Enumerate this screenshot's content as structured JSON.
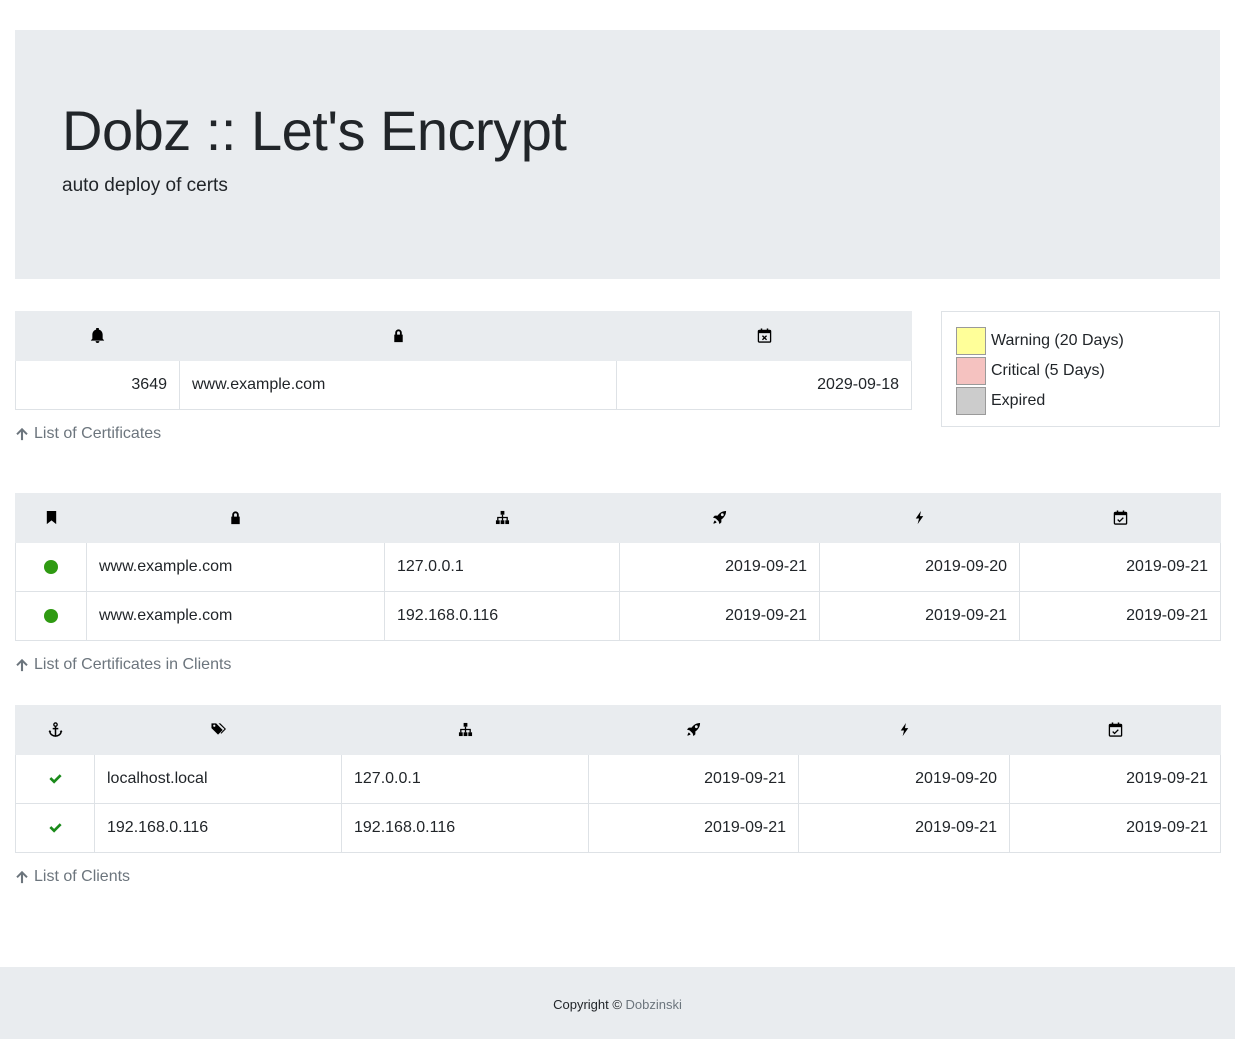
{
  "header": {
    "title": "Dobz :: Let's Encrypt",
    "subtitle": "auto deploy of certs"
  },
  "certificates": {
    "columns": [
      "bell-icon",
      "lock-icon",
      "calendar-x-icon"
    ],
    "rows": [
      {
        "days": "3649",
        "domain": "www.example.com",
        "expires": "2029-09-18"
      }
    ],
    "link_label": "List of Certificates"
  },
  "legend": {
    "items": [
      {
        "label": "Warning (20 Days)",
        "color": "#ffff99"
      },
      {
        "label": "Critical (5 Days)",
        "color": "#f5c2c0"
      },
      {
        "label": "Expired",
        "color": "#cccccc"
      }
    ]
  },
  "client_certificates": {
    "columns": [
      "bookmark-icon",
      "lock-icon",
      "sitemap-icon",
      "rocket-icon",
      "bolt-icon",
      "calendar-check-icon"
    ],
    "status_color": "#2f9a12",
    "rows": [
      {
        "domain": "www.example.com",
        "ip": "127.0.0.1",
        "deployed": "2019-09-21",
        "triggered": "2019-09-20",
        "checked": "2019-09-21"
      },
      {
        "domain": "www.example.com",
        "ip": "192.168.0.116",
        "deployed": "2019-09-21",
        "triggered": "2019-09-21",
        "checked": "2019-09-21"
      }
    ],
    "link_label": "List of Certificates in Clients"
  },
  "clients": {
    "columns": [
      "anchor-icon",
      "tags-icon",
      "sitemap-icon",
      "rocket-icon",
      "bolt-icon",
      "calendar-check-icon"
    ],
    "rows": [
      {
        "name": "localhost.local",
        "ip": "127.0.0.1",
        "deployed": "2019-09-21",
        "triggered": "2019-09-20",
        "checked": "2019-09-21"
      },
      {
        "name": "192.168.0.116",
        "ip": "192.168.0.116",
        "deployed": "2019-09-21",
        "triggered": "2019-09-21",
        "checked": "2019-09-21"
      }
    ],
    "link_label": "List of Clients"
  },
  "footer": {
    "copyright": "Copyright ©",
    "author": "Dobzinski"
  }
}
